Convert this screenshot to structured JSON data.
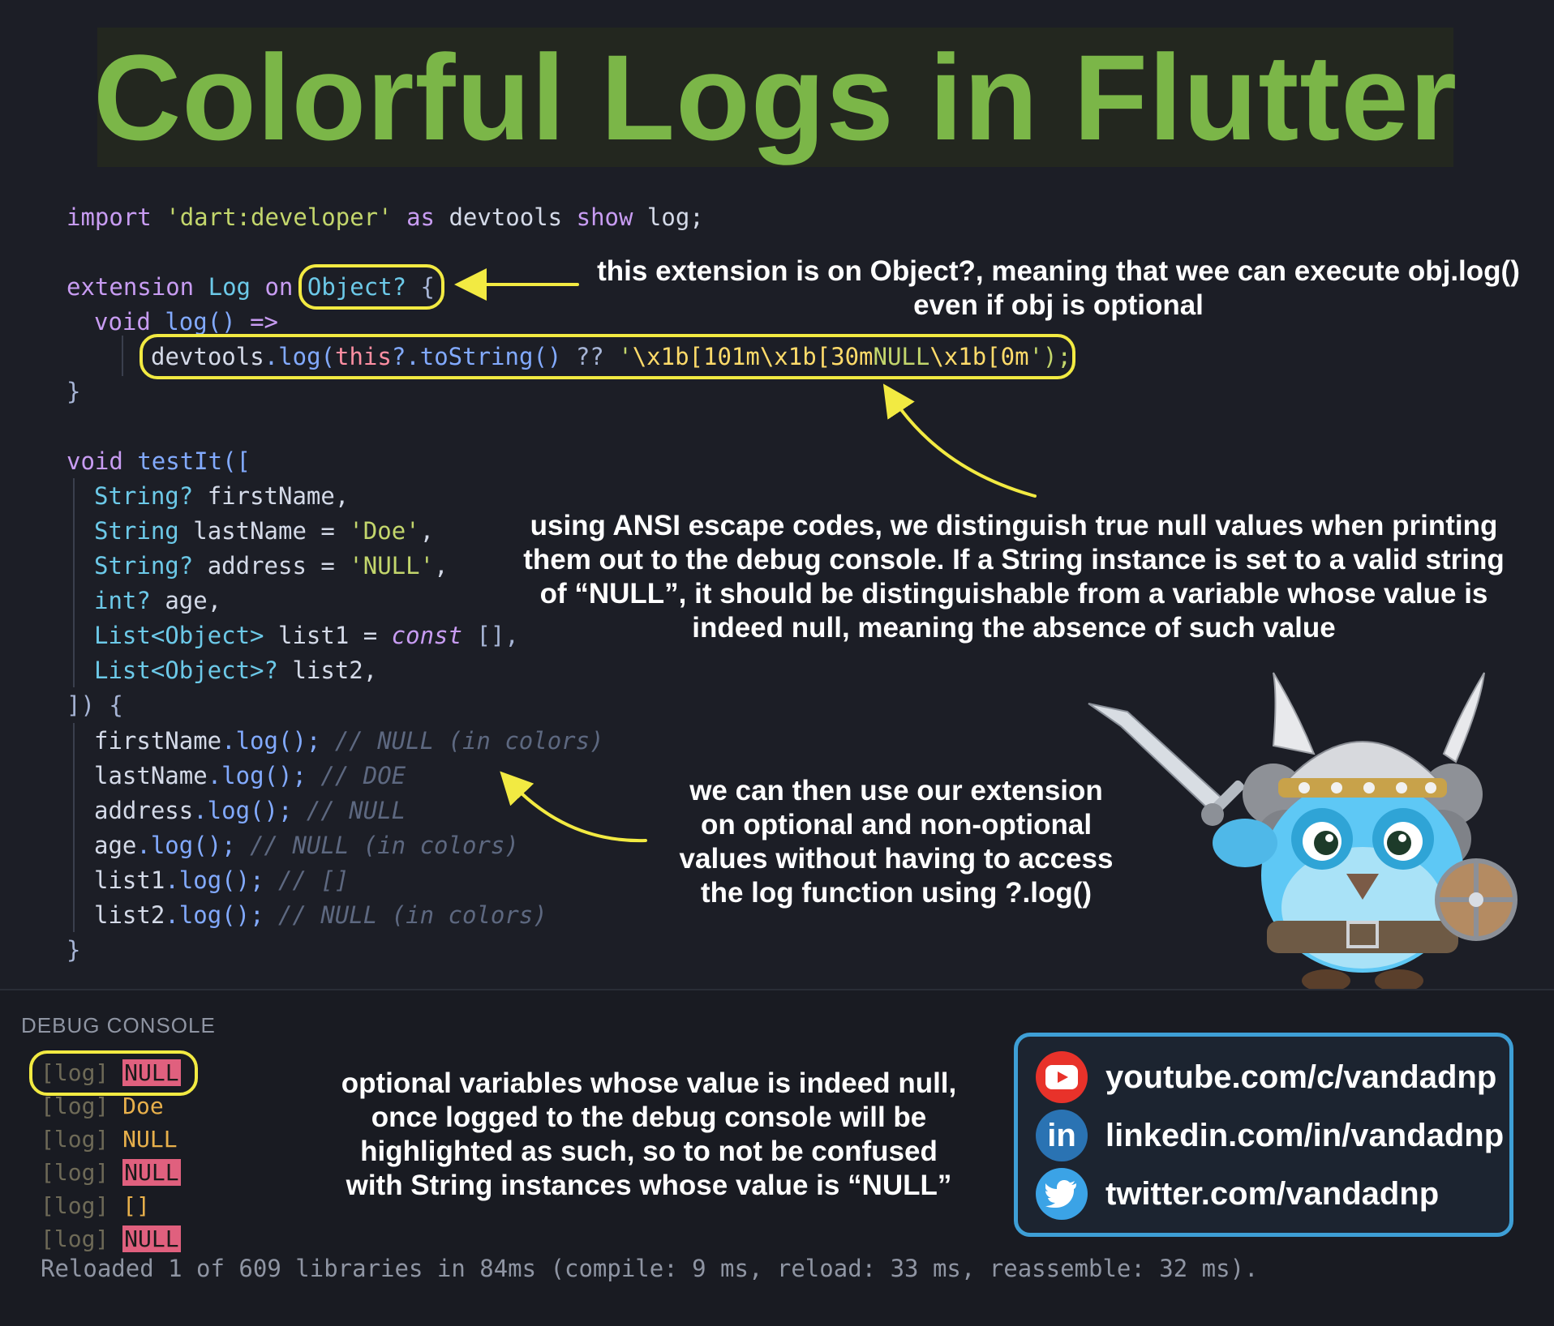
{
  "title": "Colorful Logs in Flutter",
  "code": {
    "import": [
      "import",
      "'dart:developer'",
      "as",
      "devtools",
      "show",
      "log;"
    ],
    "ext_line": [
      "extension",
      "Log",
      "on",
      "Object?",
      "{"
    ],
    "void_log": [
      "void",
      "log()",
      "=>"
    ],
    "devtools_line": [
      "devtools",
      ".log(",
      "this",
      "?.toString()",
      "??",
      "'",
      "\\x1b[101m\\x1b[30m",
      "NULL",
      "\\x1b[0m",
      "');"
    ],
    "close_brace": "}",
    "testit": [
      "void",
      "testIt([",
      ""
    ],
    "params": [
      {
        "type": "String?",
        "name": "firstName,"
      },
      {
        "type": "String",
        "name": "lastName =",
        "val": "'Doe'",
        "end": ","
      },
      {
        "type": "String?",
        "name": "address =",
        "val": "'NULL'",
        "end": ","
      },
      {
        "type": "int?",
        "name": "age,"
      },
      {
        "type": "List<Object>",
        "name": "list1 =",
        "kw": "const",
        "end": "[],"
      },
      {
        "type": "List<Object>?",
        "name": "list2,"
      }
    ],
    "open_body": "]) {",
    "calls": [
      {
        "var": "firstName",
        "call": ".log();",
        "comment": "// NULL (in colors)"
      },
      {
        "var": "lastName",
        "call": ".log();",
        "comment": "// DOE"
      },
      {
        "var": "address",
        "call": ".log();",
        "comment": "// NULL"
      },
      {
        "var": "age",
        "call": ".log();",
        "comment": "// NULL (in colors)"
      },
      {
        "var": "list1",
        "call": ".log();",
        "comment": "// []"
      },
      {
        "var": "list2",
        "call": ".log();",
        "comment": "// NULL (in colors)"
      }
    ],
    "end_brace": "}"
  },
  "notes": {
    "extension_note": [
      "this extension is on Object?, meaning that wee can execute obj.log()",
      "even if obj is optional"
    ],
    "ansi_note": [
      "using ANSI escape codes, we distinguish true null values when printing",
      "them out to the debug console. If a String instance is set to a valid string",
      "of “NULL”, it should be distinguishable from a variable whose value is",
      "indeed null, meaning the absence of such value"
    ],
    "usage_note": [
      "we can then use our extension",
      "on optional and non-optional",
      "values without having to access",
      "the log function using ?.log()"
    ],
    "console_note": [
      "optional variables whose value is indeed null,",
      "once logged to the debug console will be",
      "highlighted as such, so to not be confused",
      "with String instances whose value is “NULL”"
    ]
  },
  "console": {
    "title": "DEBUG CONSOLE",
    "lines": [
      {
        "prefix": "[log]",
        "value": "NULL",
        "highlight": true
      },
      {
        "prefix": "[log]",
        "value": "Doe",
        "highlight": false
      },
      {
        "prefix": "[log]",
        "value": "NULL",
        "highlight": false
      },
      {
        "prefix": "[log]",
        "value": "NULL",
        "highlight": true
      },
      {
        "prefix": "[log]",
        "value": "[]",
        "highlight": false
      },
      {
        "prefix": "[log]",
        "value": "NULL",
        "highlight": true
      }
    ],
    "reload": "Reloaded 1 of 609 libraries in 84ms (compile: 9 ms, reload: 33 ms, reassemble: 32 ms)."
  },
  "social": [
    {
      "icon": "youtube-icon",
      "text": "youtube.com/c/vandadnp",
      "color": "#e8322a"
    },
    {
      "icon": "linkedin-icon",
      "text": "linkedin.com/in/vandadnp",
      "color": "#2a73b3"
    },
    {
      "icon": "twitter-icon",
      "text": "twitter.com/vandadnp",
      "color": "#3ba3e6"
    }
  ],
  "colors": {
    "title": "#7bb648",
    "highlight": "#f2ea42",
    "social_border": "#3e9fd6",
    "null_bg": "#e0607e"
  }
}
